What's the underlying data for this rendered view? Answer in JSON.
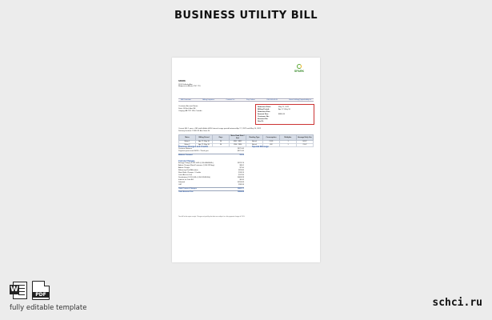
{
  "header": {
    "title": "BUSINESS UTILITY BILL"
  },
  "bill": {
    "logo_text": "SPARK",
    "sender": {
      "name": "SPARK",
      "line1": "1103 Vallecito Ave",
      "line2": "Ridgecrest, Alberta T8C 7T6"
    },
    "navbar": {
      "items": [
        "Bill Overview",
        "Billing Inquiries",
        "Contact Us",
        "Pay Online"
      ],
      "phone": "780-555-0143",
      "email": "Email: billing@sparkutility.ca"
    },
    "customer": {
      "line1": "Customer Account Name",
      "line2": "Suite 14 Birch Ave NE",
      "line3": "Calgary, AB T2P 1K8, Canada"
    },
    "account": [
      {
        "k": "Statement Date:",
        "v": "May 21, 2022"
      },
      {
        "k": "Billing Period:",
        "v": "Apr 17–May 16"
      },
      {
        "k": "Statement Due:",
        "v": ""
      },
      {
        "k": "Amount Due:",
        "v": "$884.46"
      },
      {
        "k": "Customer No:",
        "v": ""
      },
      {
        "k": "Account No:",
        "v": ""
      },
      {
        "k": "Site ID:",
        "v": ""
      }
    ],
    "note_line1": "Current Bill: 1 year = 365 total billable kWh/ Interval usage period between Apr 17, 2022 and May 16, 2022",
    "note_line2": "Delivery location: 13550 91 Ave Sans Fil",
    "usage": {
      "headers": [
        "Meter",
        "Billing Period",
        "Days",
        "Meter Read Start / End",
        "Reading Type",
        "Consumption",
        "Multiplier",
        "Average Daily Use"
      ],
      "rows": [
        [
          "Meter 1",
          "Apr 17–May 16",
          "30",
          "4301 / 6832",
          "Actual",
          "2,531",
          "1",
          "84.37"
        ],
        [
          "Meter 2",
          "Apr 17–May 16",
          "30",
          "1204 / 1896",
          "Actual",
          "692",
          "1",
          "23.07"
        ]
      ]
    },
    "previous": {
      "heading": "Previous Charges and Credits",
      "items": [
        {
          "k": "Previous Balance",
          "v": "$871.40"
        },
        {
          "k": "Payment processed 04/30 - Thank you",
          "v": "-$871.40"
        }
      ],
      "total_label": "Balance Forward",
      "total": "$0.00"
    },
    "special_heading": "Special Message",
    "current": {
      "heading": "Current Charges",
      "items": [
        {
          "k": "Energy Charge (2,531 kWh @ $0.0884/kWh)",
          "v": "$223.74"
        },
        {
          "k": "Admin Charge (Rate/Customer @ $0.287/day)",
          "v": "$8.61"
        },
        {
          "k": "Admin Charge",
          "v": "$7.50"
        },
        {
          "k": "Balancing Pool Allocation",
          "v": "$26.80"
        },
        {
          "k": "Rate Rider Charges / Credits",
          "v": "$18.24"
        },
        {
          "k": "Local Access Fee",
          "v": "$12.95"
        },
        {
          "k": "Distribution (2,531 kWh @ $0.1853/kWh)",
          "v": "$468.99"
        },
        {
          "k": "Interest on Late Bill",
          "v": "$0.00"
        },
        {
          "k": "Subtotal",
          "v": "$766.83"
        },
        {
          "k": "GST",
          "v": "$38.34"
        }
      ],
      "total_label": "Total Current Charges",
      "total": "$805.17"
    },
    "amount_due_label": "Total Amount Due",
    "amount_due": "$884.46",
    "footer": "Your bill is due upon receipt. Charges not paid by due date are subject to a late payment charge of 2.0%."
  },
  "bottom": {
    "word_letter": "W",
    "pdf_label": "PDF",
    "tagline": "fully editable template",
    "brand": "schci.ru"
  }
}
